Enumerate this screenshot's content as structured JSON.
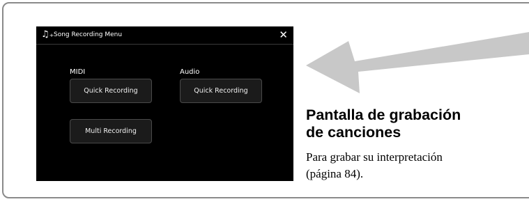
{
  "screen": {
    "title": "Song Recording Menu",
    "title_icon": "music-note-plus-icon",
    "close_icon": "close-icon",
    "close_glyph": "✕",
    "sections": {
      "midi": {
        "label": "MIDI",
        "buttons": [
          "Quick Recording",
          "Multi Recording"
        ]
      },
      "audio": {
        "label": "Audio",
        "buttons": [
          "Quick Recording"
        ]
      }
    }
  },
  "callout": {
    "heading_line1": "Pantalla de grabación",
    "heading_line2": "de canciones",
    "body_line1": "Para grabar su interpretación",
    "body_line2": "(página 84)."
  },
  "colors": {
    "screen_bg": "#000000",
    "button_bg": "#1b1b1b",
    "button_border": "#4a4a4a",
    "arrow": "#c8c8c8",
    "frame_border": "#8a8a8a"
  }
}
